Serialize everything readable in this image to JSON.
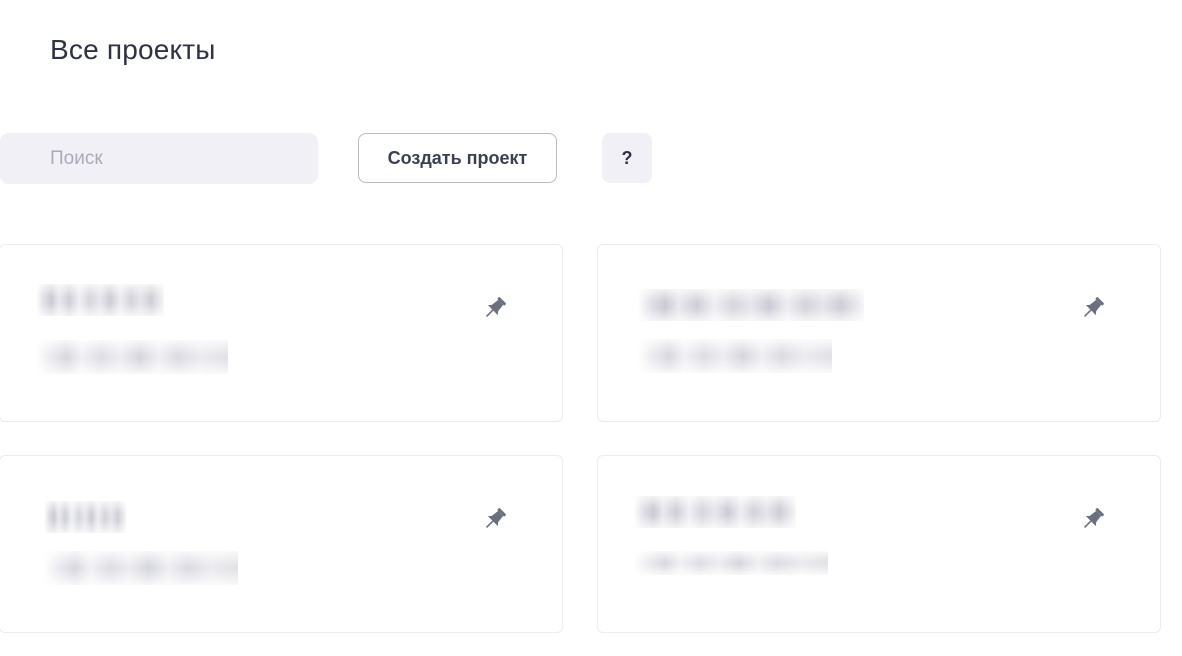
{
  "header": {
    "title": "Все проекты"
  },
  "toolbar": {
    "search_placeholder": "Поиск",
    "create_label": "Создать проект",
    "help_label": "?"
  },
  "projects": [
    {
      "name": "",
      "description": "",
      "pinned": false
    },
    {
      "name": "",
      "description": "",
      "pinned": false
    },
    {
      "name": "",
      "description": "",
      "pinned": false
    },
    {
      "name": "",
      "description": "",
      "pinned": false
    }
  ],
  "icons": {
    "pin": "pushpin-icon"
  },
  "colors": {
    "title": "#2e3245",
    "search_bg": "#f0f0f6",
    "placeholder": "#a9abb8",
    "button_border": "#b9bac4",
    "card_border": "#ebebf0",
    "pin_icon": "#6b6f7e"
  }
}
